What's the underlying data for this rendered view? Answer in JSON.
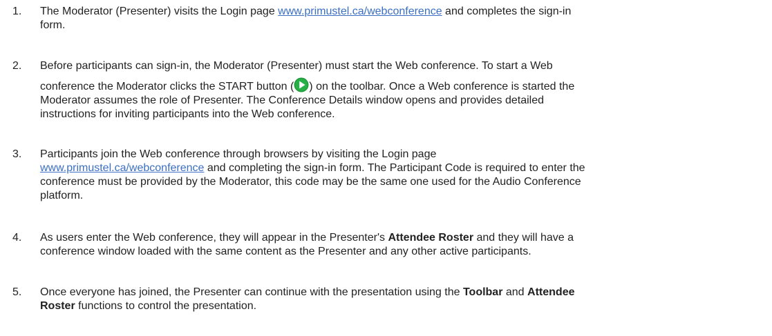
{
  "steps": [
    {
      "number": "1.",
      "l1_a": "The Moderator (Presenter) visits the Login page ",
      "l1_link": "www.primustel.ca/webconference",
      "l1_b": " and completes the sign-in",
      "l2": "form."
    },
    {
      "number": "2.",
      "l1": "Before participants can sign-in, the Moderator (Presenter) must start the Web conference. To start a Web",
      "l2_a": "conference the Moderator clicks the START button (",
      "icon": "start-play-icon",
      "l2_b": ") on the toolbar. Once a Web conference is started the",
      "l3": "Moderator assumes the role of Presenter. The Conference Details window opens and provides detailed",
      "l4": "instructions for inviting participants into the Web conference."
    },
    {
      "number": "3.",
      "l1": "Participants join the Web conference through browsers by visiting the Login page",
      "l2_link": "www.primustel.ca/webconference",
      "l2_b": " and completing the sign-in form. The Participant Code is required to enter the",
      "l3": "conference must be provided by the Moderator, this code may be the same one used for the Audio Conference",
      "l4": "platform."
    },
    {
      "number": "4.",
      "l1_a": "As users enter the Web conference, they will appear in the Presenter's ",
      "l1_bold": "Attendee Roster",
      "l1_b": " and they will have a",
      "l2": "conference window loaded with the same content as the Presenter and any other active participants."
    },
    {
      "number": "5.",
      "l1_a": "Once everyone has joined, the Presenter can continue with the presentation using the ",
      "l1_bold1": "Toolbar",
      "l1_mid": " and ",
      "l1_bold2": "Attendee",
      "l2_bold": "Roster",
      "l2_b": " functions to control the presentation."
    }
  ],
  "colors": {
    "text": "#222222",
    "link": "#3b6fc4",
    "start_icon_fill": "#1f9a3a",
    "start_icon_arrow": "#ffffff"
  }
}
